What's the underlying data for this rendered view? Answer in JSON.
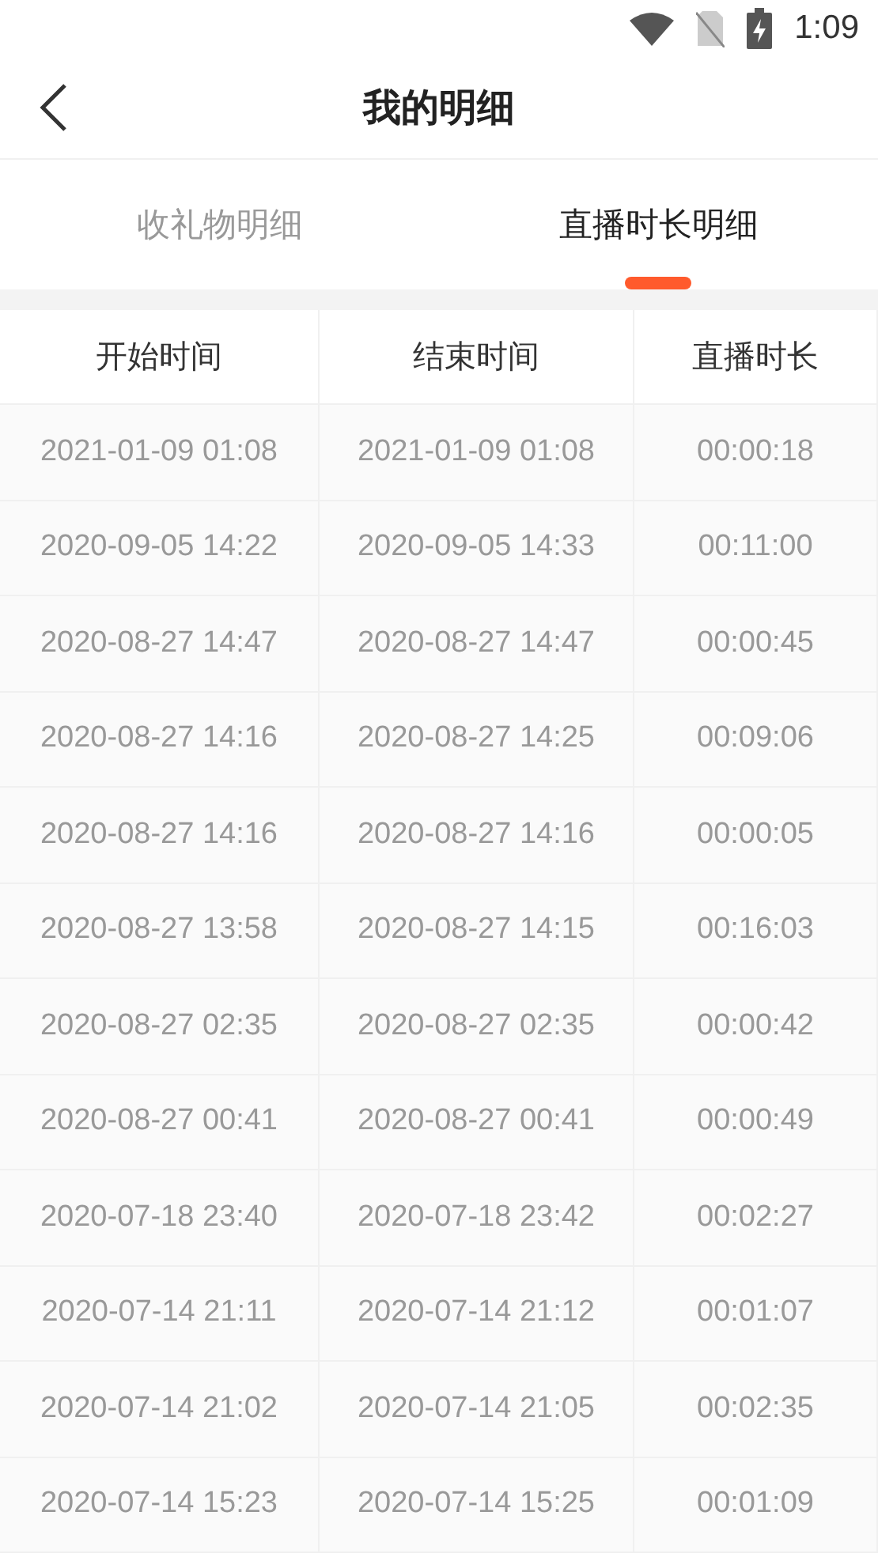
{
  "status_bar": {
    "time": "1:09"
  },
  "header": {
    "title": "我的明细"
  },
  "tabs": [
    {
      "label": "收礼物明细",
      "selected": false
    },
    {
      "label": "直播时长明细",
      "selected": true
    }
  ],
  "table": {
    "columns": [
      "开始时间",
      "结束时间",
      "直播时长"
    ],
    "rows": [
      [
        "2021-01-09 01:08",
        "2021-01-09 01:08",
        "00:00:18"
      ],
      [
        "2020-09-05 14:22",
        "2020-09-05 14:33",
        "00:11:00"
      ],
      [
        "2020-08-27 14:47",
        "2020-08-27 14:47",
        "00:00:45"
      ],
      [
        "2020-08-27 14:16",
        "2020-08-27 14:25",
        "00:09:06"
      ],
      [
        "2020-08-27 14:16",
        "2020-08-27 14:16",
        "00:00:05"
      ],
      [
        "2020-08-27 13:58",
        "2020-08-27 14:15",
        "00:16:03"
      ],
      [
        "2020-08-27 02:35",
        "2020-08-27 02:35",
        "00:00:42"
      ],
      [
        "2020-08-27 00:41",
        "2020-08-27 00:41",
        "00:00:49"
      ],
      [
        "2020-07-18 23:40",
        "2020-07-18 23:42",
        "00:02:27"
      ],
      [
        "2020-07-14 21:11",
        "2020-07-14 21:12",
        "00:01:07"
      ],
      [
        "2020-07-14 21:02",
        "2020-07-14 21:05",
        "00:02:35"
      ],
      [
        "2020-07-14 15:23",
        "2020-07-14 15:25",
        "00:01:09"
      ]
    ]
  }
}
